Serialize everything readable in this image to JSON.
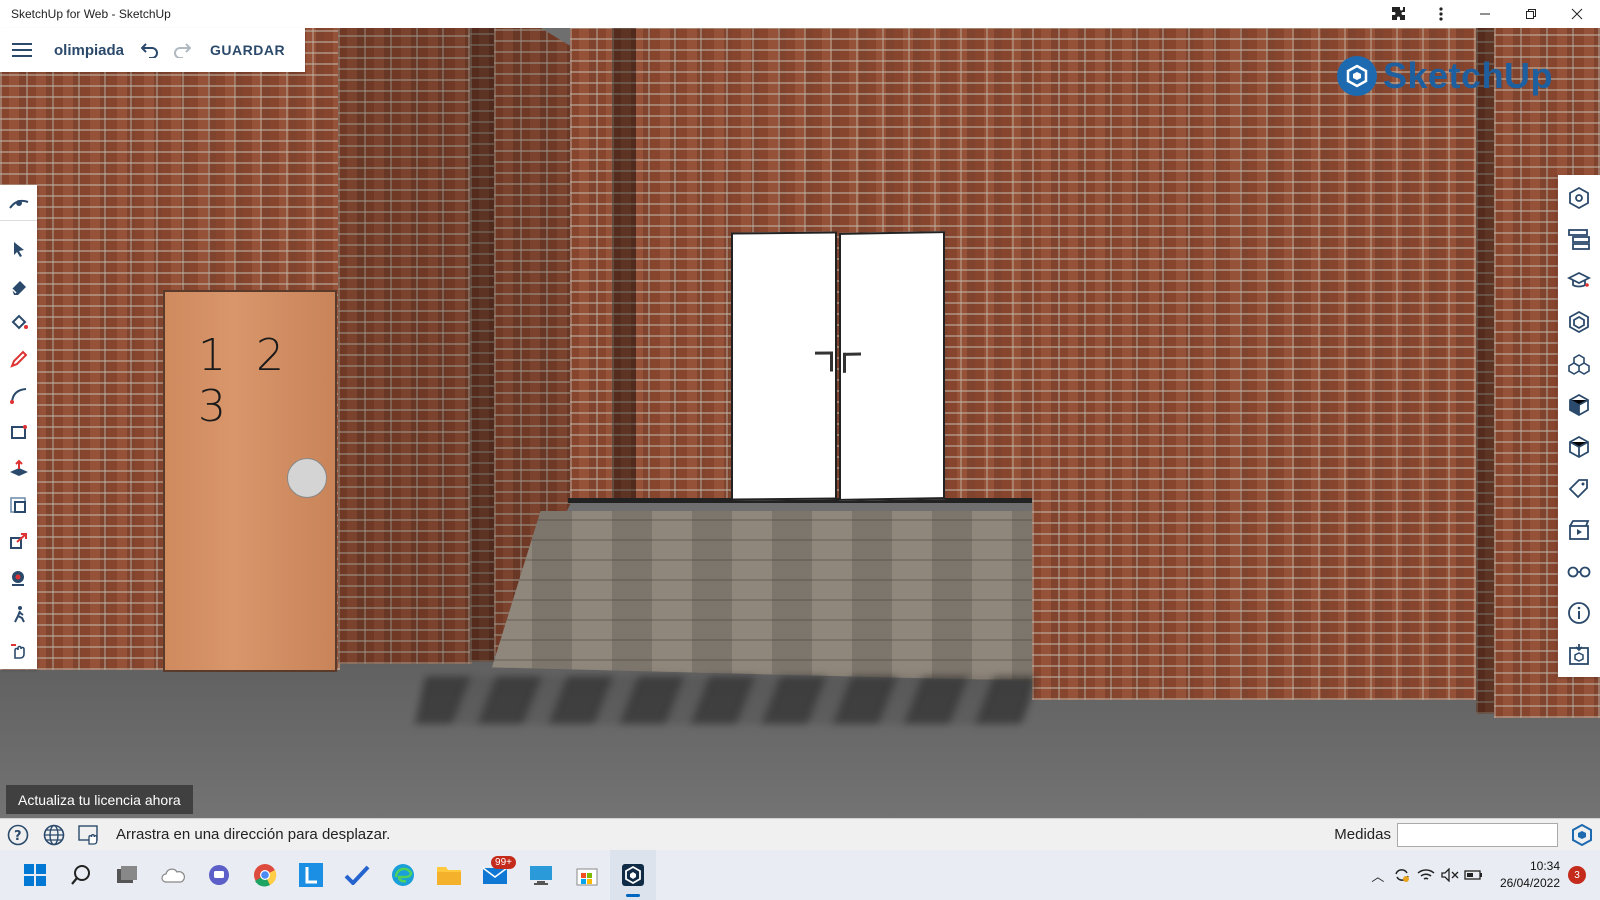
{
  "window": {
    "title": "SketchUp for Web - SketchUp"
  },
  "docbar": {
    "doc_name": "olimpiada",
    "save_label": "GUARDAR"
  },
  "scene": {
    "door_number": "1 2 3",
    "logo_text": "SketchUp"
  },
  "left_toolbar": [
    "orbit-icon",
    "select-icon",
    "eraser-icon",
    "paint-bucket-icon",
    "pencil-icon",
    "arc-icon",
    "rectangle-icon",
    "push-pull-icon",
    "offset-icon",
    "scale-icon",
    "position-camera-icon",
    "walk-icon",
    "pan-icon"
  ],
  "right_toolbar": [
    "entity-info-icon",
    "outliner-icon",
    "instructor-icon",
    "components-icon",
    "materials-icon",
    "styles-icon",
    "scenes-icon",
    "tags-icon",
    "animation-icon",
    "display-icon",
    "info-icon",
    "3d-warehouse-icon"
  ],
  "license_button": "Actualiza tu licencia ahora",
  "statusbar": {
    "hint": "Arrastra en una dirección para desplazar.",
    "measure_label": "Medidas",
    "measure_value": ""
  },
  "taskbar": {
    "mail_badge": "99+",
    "time": "10:34",
    "date": "26/04/2022",
    "notifications": "3"
  },
  "colors": {
    "brand": "#1e6ab0",
    "text_dark": "#2b4a6b",
    "accent": "#0067c0"
  }
}
